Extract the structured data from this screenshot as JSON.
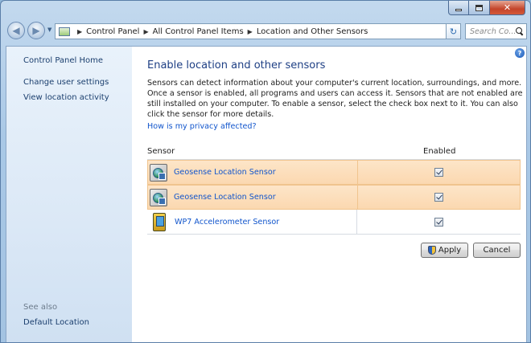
{
  "window": {
    "caption_buttons": {
      "minimize": "minimize-icon",
      "maximize": "maximize-icon",
      "close": "✕"
    }
  },
  "navigation": {
    "breadcrumbs": [
      "Control Panel",
      "All Control Panel Items",
      "Location and Other Sensors"
    ],
    "search_placeholder": "Search Co..."
  },
  "sidebar": {
    "home": "Control Panel Home",
    "links": [
      "Change user settings",
      "View location activity"
    ],
    "see_also_label": "See also",
    "see_also_links": [
      "Default Location"
    ]
  },
  "main": {
    "title": "Enable location and other sensors",
    "description": "Sensors can detect information about your computer's current location, surroundings, and more. Once a sensor is enabled, all programs and users can access it. Sensors that are not enabled are still installed on your computer. To enable a sensor, select the check box next to it. You can also click the sensor for more details.",
    "privacy_link": "How is my privacy affected?",
    "columns": {
      "sensor": "Sensor",
      "enabled": "Enabled"
    },
    "sensors": [
      {
        "name": "Geosense Location Sensor",
        "enabled": true,
        "selected": true,
        "icon": "location-sensor-icon"
      },
      {
        "name": "Geosense Location Sensor",
        "enabled": true,
        "selected": true,
        "icon": "location-sensor-icon"
      },
      {
        "name": "WP7 Accelerometer Sensor",
        "enabled": true,
        "selected": false,
        "icon": "accelerometer-icon"
      }
    ],
    "buttons": {
      "apply": "Apply",
      "cancel": "Cancel"
    }
  },
  "colors": {
    "link": "#1155cc",
    "heading": "#1e3f84",
    "row_highlight": "#fbd8b0"
  }
}
